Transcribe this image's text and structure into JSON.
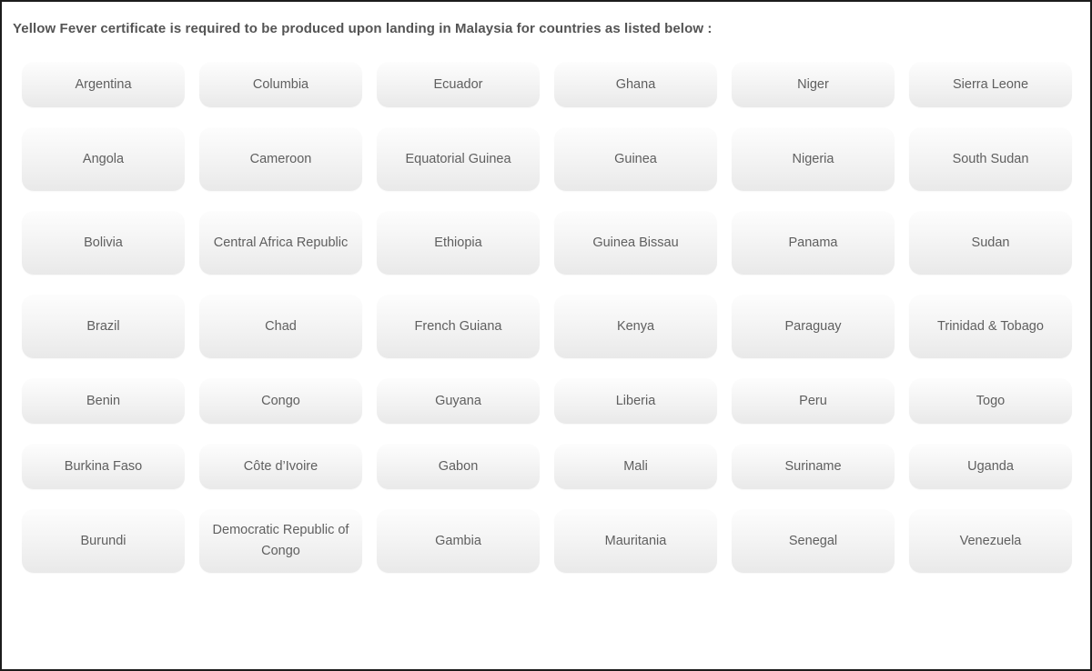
{
  "notice": {
    "title": "Yellow Fever certificate is required to be produced upon landing in Malaysia for countries as listed below :"
  },
  "colors": {
    "page_border": "#1c1c1c",
    "title_text": "#545454",
    "chip_text": "#5f5f5f",
    "chip_gradient_top": "#fdfdfd",
    "chip_gradient_bottom": "#e9e9e9",
    "page_background": "#ffffff"
  },
  "grid": {
    "columns": 6,
    "rows": 7,
    "total_countries": 42,
    "items": [
      {
        "label": "Argentina",
        "row": 1,
        "col": 1,
        "lines": 1
      },
      {
        "label": "Columbia",
        "row": 1,
        "col": 2,
        "lines": 1
      },
      {
        "label": "Ecuador",
        "row": 1,
        "col": 3,
        "lines": 1
      },
      {
        "label": "Ghana",
        "row": 1,
        "col": 4,
        "lines": 1
      },
      {
        "label": "Niger",
        "row": 1,
        "col": 5,
        "lines": 1
      },
      {
        "label": "Sierra Leone",
        "row": 1,
        "col": 6,
        "lines": 1
      },
      {
        "label": "Angola",
        "row": 2,
        "col": 1,
        "lines": 1
      },
      {
        "label": "Cameroon",
        "row": 2,
        "col": 2,
        "lines": 1
      },
      {
        "label": "Equatorial Guinea",
        "row": 2,
        "col": 3,
        "lines": 2
      },
      {
        "label": "Guinea",
        "row": 2,
        "col": 4,
        "lines": 1
      },
      {
        "label": "Nigeria",
        "row": 2,
        "col": 5,
        "lines": 1
      },
      {
        "label": "South Sudan",
        "row": 2,
        "col": 6,
        "lines": 1
      },
      {
        "label": "Bolivia",
        "row": 3,
        "col": 1,
        "lines": 1
      },
      {
        "label": "Central Africa Republic",
        "row": 3,
        "col": 2,
        "lines": 2
      },
      {
        "label": "Ethiopia",
        "row": 3,
        "col": 3,
        "lines": 1
      },
      {
        "label": "Guinea Bissau",
        "row": 3,
        "col": 4,
        "lines": 1
      },
      {
        "label": "Panama",
        "row": 3,
        "col": 5,
        "lines": 1
      },
      {
        "label": "Sudan",
        "row": 3,
        "col": 6,
        "lines": 1
      },
      {
        "label": "Brazil",
        "row": 4,
        "col": 1,
        "lines": 1
      },
      {
        "label": "Chad",
        "row": 4,
        "col": 2,
        "lines": 1
      },
      {
        "label": "French Guiana",
        "row": 4,
        "col": 3,
        "lines": 1
      },
      {
        "label": "Kenya",
        "row": 4,
        "col": 4,
        "lines": 1
      },
      {
        "label": "Paraguay",
        "row": 4,
        "col": 5,
        "lines": 1
      },
      {
        "label": "Trinidad & Tobago",
        "row": 4,
        "col": 6,
        "lines": 2
      },
      {
        "label": "Benin",
        "row": 5,
        "col": 1,
        "lines": 1
      },
      {
        "label": "Congo",
        "row": 5,
        "col": 2,
        "lines": 1
      },
      {
        "label": "Guyana",
        "row": 5,
        "col": 3,
        "lines": 1
      },
      {
        "label": "Liberia",
        "row": 5,
        "col": 4,
        "lines": 1
      },
      {
        "label": "Peru",
        "row": 5,
        "col": 5,
        "lines": 1
      },
      {
        "label": "Togo",
        "row": 5,
        "col": 6,
        "lines": 1
      },
      {
        "label": "Burkina Faso",
        "row": 6,
        "col": 1,
        "lines": 1
      },
      {
        "label": "Côte d’Ivoire",
        "row": 6,
        "col": 2,
        "lines": 1
      },
      {
        "label": "Gabon",
        "row": 6,
        "col": 3,
        "lines": 1
      },
      {
        "label": "Mali",
        "row": 6,
        "col": 4,
        "lines": 1
      },
      {
        "label": "Suriname",
        "row": 6,
        "col": 5,
        "lines": 1
      },
      {
        "label": "Uganda",
        "row": 6,
        "col": 6,
        "lines": 1
      },
      {
        "label": "Burundi",
        "row": 7,
        "col": 1,
        "lines": 1
      },
      {
        "label": "Democratic Republic of Congo",
        "row": 7,
        "col": 2,
        "lines": 3
      },
      {
        "label": "Gambia",
        "row": 7,
        "col": 3,
        "lines": 1
      },
      {
        "label": "Mauritania",
        "row": 7,
        "col": 4,
        "lines": 1
      },
      {
        "label": "Senegal",
        "row": 7,
        "col": 5,
        "lines": 1
      },
      {
        "label": "Venezuela",
        "row": 7,
        "col": 6,
        "lines": 1
      }
    ]
  }
}
